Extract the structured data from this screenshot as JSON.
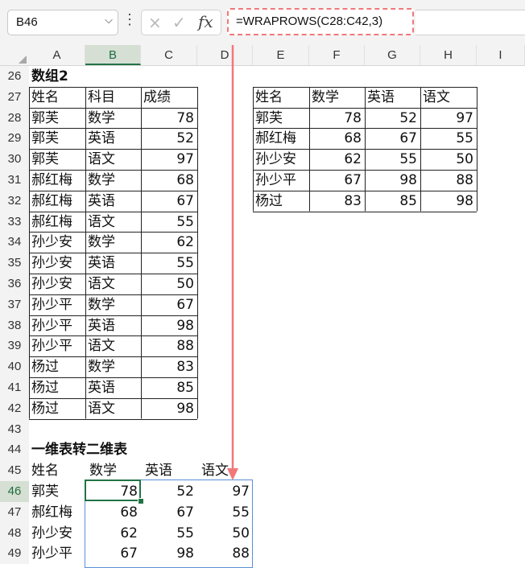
{
  "name_box": {
    "value": "B46",
    "dropdown_icon": "chevron-down-icon"
  },
  "formula_bar": {
    "cancel_icon": "×",
    "confirm_icon": "✓",
    "fx_label": "fx",
    "formula": "=WRAPROWS(C28:C42,3)"
  },
  "columns": [
    "A",
    "B",
    "C",
    "D",
    "E",
    "F",
    "G",
    "H",
    "I"
  ],
  "selected_column": "B",
  "rows": [
    26,
    27,
    28,
    29,
    30,
    31,
    32,
    33,
    34,
    35,
    36,
    37,
    38,
    39,
    40,
    41,
    42,
    43,
    44,
    45,
    46,
    47,
    48,
    49
  ],
  "selected_row": 46,
  "source_table": {
    "title": "数组2",
    "headers": [
      "姓名",
      "科目",
      "成绩"
    ],
    "rows": [
      [
        "郭芙",
        "数学",
        "78"
      ],
      [
        "郭芙",
        "英语",
        "52"
      ],
      [
        "郭芙",
        "语文",
        "97"
      ],
      [
        "郝红梅",
        "数学",
        "68"
      ],
      [
        "郝红梅",
        "英语",
        "67"
      ],
      [
        "郝红梅",
        "语文",
        "55"
      ],
      [
        "孙少安",
        "数学",
        "62"
      ],
      [
        "孙少安",
        "英语",
        "55"
      ],
      [
        "孙少安",
        "语文",
        "50"
      ],
      [
        "孙少平",
        "数学",
        "67"
      ],
      [
        "孙少平",
        "英语",
        "98"
      ],
      [
        "孙少平",
        "语文",
        "88"
      ],
      [
        "杨过",
        "数学",
        "83"
      ],
      [
        "杨过",
        "英语",
        "85"
      ],
      [
        "杨过",
        "语文",
        "98"
      ]
    ]
  },
  "result_table": {
    "headers": [
      "姓名",
      "数学",
      "英语",
      "语文"
    ],
    "rows": [
      [
        "郭芙",
        "78",
        "52",
        "97"
      ],
      [
        "郝红梅",
        "68",
        "67",
        "55"
      ],
      [
        "孙少安",
        "62",
        "55",
        "50"
      ],
      [
        "孙少平",
        "67",
        "98",
        "88"
      ],
      [
        "杨过",
        "83",
        "85",
        "98"
      ]
    ]
  },
  "bottom_section": {
    "title": "一维表转二维表",
    "headers": [
      "姓名",
      "数学",
      "英语",
      "语文"
    ],
    "rows": [
      [
        "郭芙",
        "78",
        "52",
        "97"
      ],
      [
        "郝红梅",
        "68",
        "67",
        "55"
      ],
      [
        "孙少安",
        "62",
        "55",
        "50"
      ],
      [
        "孙少平",
        "67",
        "98",
        "88"
      ]
    ]
  },
  "colors": {
    "accent": "#217346",
    "arrow": "#f07878",
    "spill_border": "#5a8fd6"
  }
}
